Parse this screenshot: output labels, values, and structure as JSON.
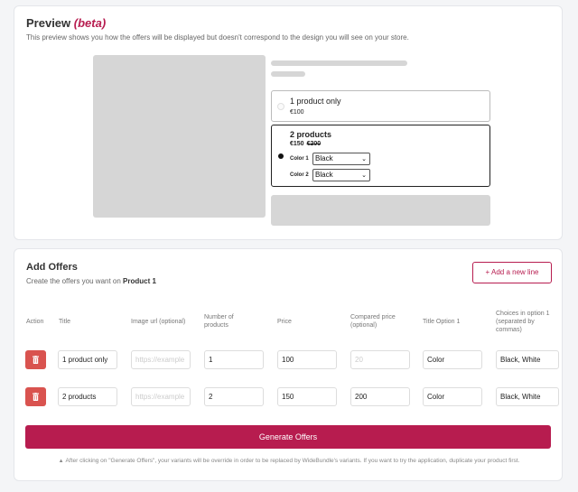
{
  "preview": {
    "title": "Preview",
    "beta": "(beta)",
    "description": "This preview shows you how the offers will be displayed but doesn't correspond to the design you will see on your store.",
    "offers": [
      {
        "title": "1 product only",
        "price": "€100",
        "compared": ""
      },
      {
        "title": "2 products",
        "price": "€150",
        "compared": "€200",
        "variants": [
          {
            "label": "Color 1",
            "value": "Black"
          },
          {
            "label": "Color 2",
            "value": "Black"
          }
        ]
      }
    ]
  },
  "offers": {
    "title": "Add Offers",
    "subtitle_prefix": "Create the offers you want on",
    "product": "Product 1",
    "add_line_label": "+ Add a new line",
    "columns": {
      "action": "Action",
      "title": "Title",
      "image": "Image url (optional)",
      "count": "Number of products",
      "price": "Price",
      "compared": "Compared price (optional)",
      "title_option": "Title Option 1",
      "choices": "Choices in option 1 (separated by commas)"
    },
    "rows": [
      {
        "title": "1 product only",
        "image_placeholder": "https://example",
        "count": "1",
        "price": "100",
        "compared": "",
        "compared_placeholder": "20",
        "title_option": "Color",
        "choices": "Black, White"
      },
      {
        "title": "2 products",
        "image_placeholder": "https://example",
        "count": "2",
        "price": "150",
        "compared": "200",
        "compared_placeholder": "",
        "title_option": "Color",
        "choices": "Black, White"
      }
    ],
    "generate_label": "Generate Offers",
    "note": "After clicking on \"Generate Offers\", your variants will be override in order to be replaced by WideBundle's variants. If you want to try the application, duplicate your product first."
  },
  "colors": {
    "accent": "#b71c4f",
    "delete": "#d9534f",
    "placeholder": "#d6d6d6"
  }
}
